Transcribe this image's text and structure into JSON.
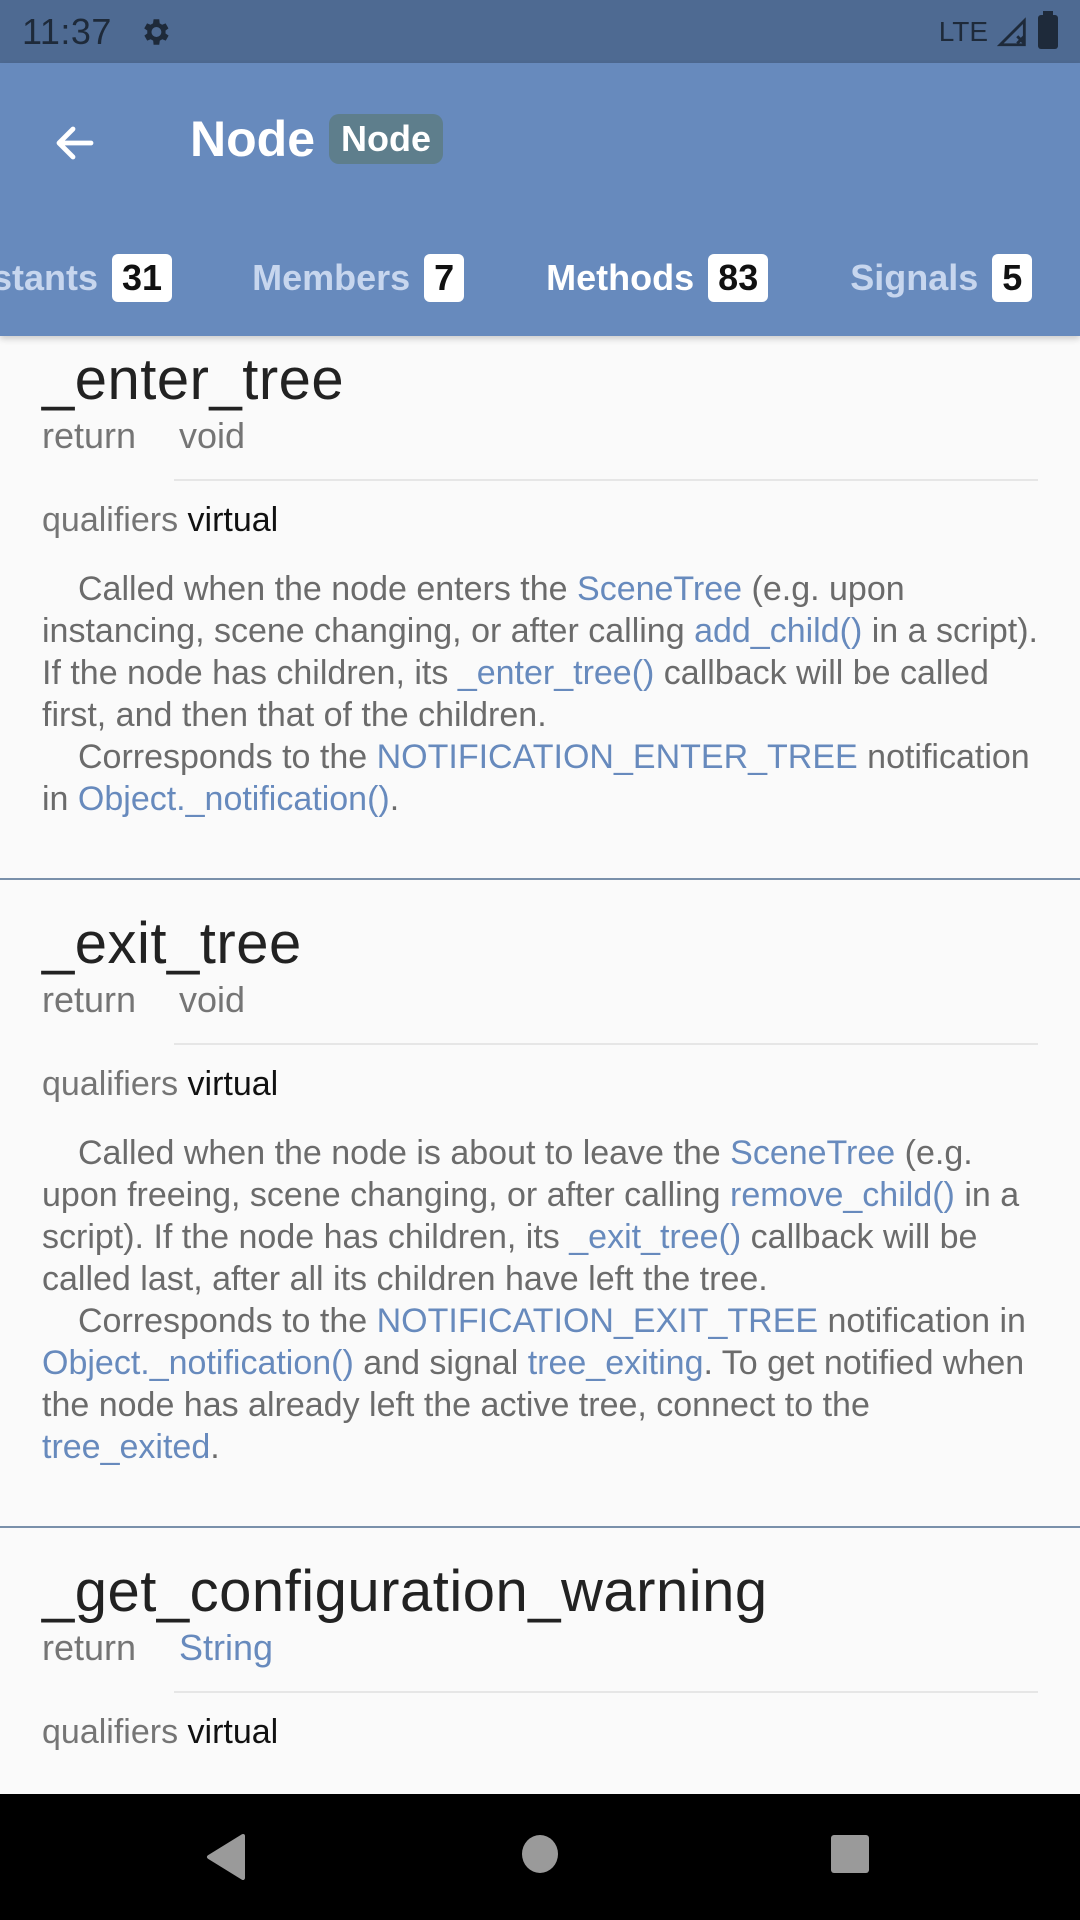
{
  "status_bar": {
    "time": "11:37",
    "network": "LTE",
    "icons": [
      "gear-icon",
      "signal-icon",
      "battery-icon"
    ]
  },
  "app_bar": {
    "back_icon": "arrow-left-icon",
    "title": "Node",
    "badge": "Node",
    "colors": {
      "app_bar": "#678abd",
      "badge": "#5e7e8c",
      "link": "#678abd"
    }
  },
  "tabs": [
    {
      "label": "stants",
      "count": "31",
      "active": false
    },
    {
      "label": "Members",
      "count": "7",
      "active": false
    },
    {
      "label": "Methods",
      "count": "83",
      "active": true
    },
    {
      "label": "Signals",
      "count": "5",
      "active": false
    }
  ],
  "methods": [
    {
      "name": "_enter_tree",
      "return_label": "return",
      "return_type": "void",
      "qualifiers_label": "qualifiers",
      "qualifiers_value": "virtual",
      "description": {
        "p1": {
          "t1": "Called when the node enters the ",
          "l1": "SceneTree",
          "t2": " (e.g. upon instancing, scene changing, or after calling ",
          "l2": "add_child()",
          "t3": " in a script). If the node has children, its ",
          "l3": "_enter_tree()",
          "t4": " callback will be called first, and then that of the children."
        },
        "p2": {
          "t1": "Corresponds to the ",
          "l1": "NOTIFICATION_ENTER_TREE",
          "t2": " notification in ",
          "l2": "Object._notification()",
          "t3": "."
        }
      }
    },
    {
      "name": "_exit_tree",
      "return_label": "return",
      "return_type": "void",
      "qualifiers_label": "qualifiers",
      "qualifiers_value": "virtual",
      "description": {
        "p1": {
          "t1": "Called when the node is about to leave the ",
          "l1": "SceneTree",
          "t2": " (e.g. upon freeing, scene changing, or after calling ",
          "l2": "remove_child()",
          "t3": " in a script). If the node has children, its ",
          "l3": "_exit_tree()",
          "t4": " callback will be called last, after all its children have left the tree."
        },
        "p2": {
          "t1": "Corresponds to the ",
          "l1": "NOTIFICATION_EXIT_TREE",
          "t2": " notification in ",
          "l2": "Object._notification()",
          "t3": " and signal ",
          "l3": "tree_exiting",
          "t4": ". To get notified when the node has already left the active tree, connect to the ",
          "l4": "tree_exited",
          "t5": "."
        }
      }
    },
    {
      "name": "_get_configuration_warning",
      "return_label": "return",
      "return_type": "String",
      "qualifiers_label": "qualifiers",
      "qualifiers_value": "virtual"
    }
  ],
  "nav_bar": {
    "buttons": [
      "back-triangle-icon",
      "home-circle-icon",
      "recents-square-icon"
    ]
  }
}
